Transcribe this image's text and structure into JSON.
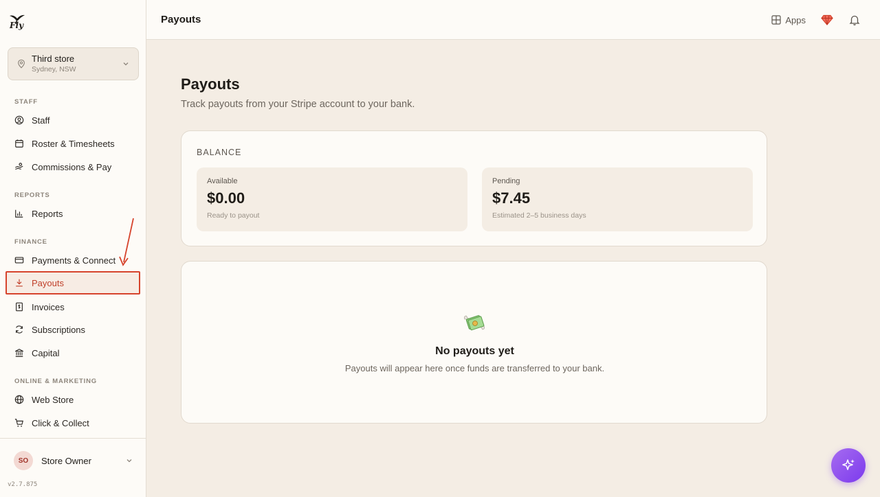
{
  "brand": {
    "logo_text": "Fly"
  },
  "store": {
    "name": "Third store",
    "location": "Sydney, NSW"
  },
  "sidebar": {
    "sections": {
      "staff": "STAFF",
      "reports": "REPORTS",
      "finance": "FINANCE",
      "online": "ONLINE & MARKETING"
    },
    "items": {
      "staff": "Staff",
      "roster": "Roster & Timesheets",
      "commissions": "Commissions & Pay",
      "reports": "Reports",
      "payments": "Payments & Connect",
      "payouts": "Payouts",
      "invoices": "Invoices",
      "subscriptions": "Subscriptions",
      "capital": "Capital",
      "webstore": "Web Store",
      "clickcollect": "Click & Collect"
    },
    "user": {
      "initials": "SO",
      "name": "Store Owner"
    },
    "version": "v2.7.875"
  },
  "topbar": {
    "title": "Payouts",
    "apps_label": "Apps"
  },
  "page": {
    "title": "Payouts",
    "subtitle": "Track payouts from your Stripe account to your bank."
  },
  "balance": {
    "label": "BALANCE",
    "available": {
      "label": "Available",
      "value": "$0.00",
      "note": "Ready to payout"
    },
    "pending": {
      "label": "Pending",
      "value": "$7.45",
      "note": "Estimated 2–5 business days"
    }
  },
  "empty_state": {
    "title": "No payouts yet",
    "subtitle": "Payouts will appear here once funds are transferred to your bank."
  },
  "colors": {
    "accent_red": "#d6432c",
    "fab_purple": "#7c3aed",
    "background": "#f4ede4"
  }
}
